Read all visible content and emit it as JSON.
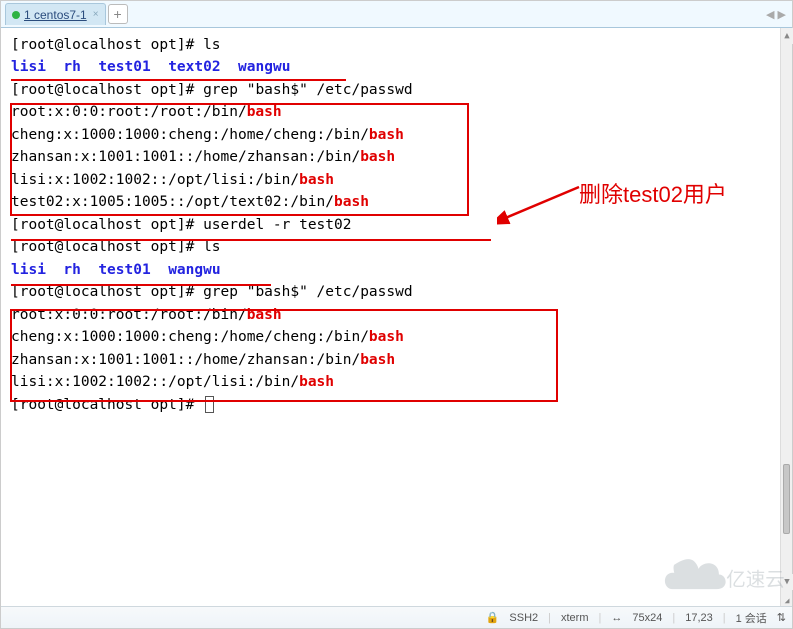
{
  "tab": {
    "label": "1 centos7-1",
    "close": "×",
    "add": "+",
    "arrows": "◀ ▶"
  },
  "annotation": {
    "label": "删除test02用户"
  },
  "terminal": {
    "prompt": "[root@localhost opt]# ",
    "cmds": {
      "ls": "ls",
      "grep": "grep \"bash$\" /etc/passwd",
      "userdel": "userdel -r test02"
    },
    "ls1": {
      "a": "lisi",
      "b": "rh",
      "c": "test01",
      "d": "text02",
      "e": "wangwu"
    },
    "ls2": {
      "a": "lisi",
      "b": "rh",
      "c": "test01",
      "d": "wangwu"
    },
    "grep1": {
      "l0a": "root:x:0:0:root:/root:/bin/",
      "l0b": "bash",
      "l1a": "cheng:x:1000:1000:cheng:/home/cheng:/bin/",
      "l1b": "bash",
      "l2a": "zhansan:x:1001:1001::/home/zhansan:/bin/",
      "l2b": "bash",
      "l3a": "lisi:x:1002:1002::/opt/lisi:/bin/",
      "l3b": "bash",
      "l4a": "test02:x:1005:1005::/opt/text02:/bin/",
      "l4b": "bash"
    },
    "grep2": {
      "l0a": "root:x:0:0:root:/root:/bin/",
      "l0b": "bash",
      "l1a": "cheng:x:1000:1000:cheng:/home/cheng:/bin/",
      "l1b": "bash",
      "l2a": "zhansan:x:1001:1001::/home/zhansan:/bin/",
      "l2b": "bash",
      "l3a": "lisi:x:1002:1002::/opt/lisi:/bin/",
      "l3b": "bash"
    }
  },
  "status": {
    "ssh": "SSH2",
    "xterm": "xterm",
    "size": "75x24",
    "pos": "17,23",
    "sessions": "1 会话",
    "arrows_icon": "⇅",
    "size_icon": "↔"
  },
  "watermark": "亿速云"
}
